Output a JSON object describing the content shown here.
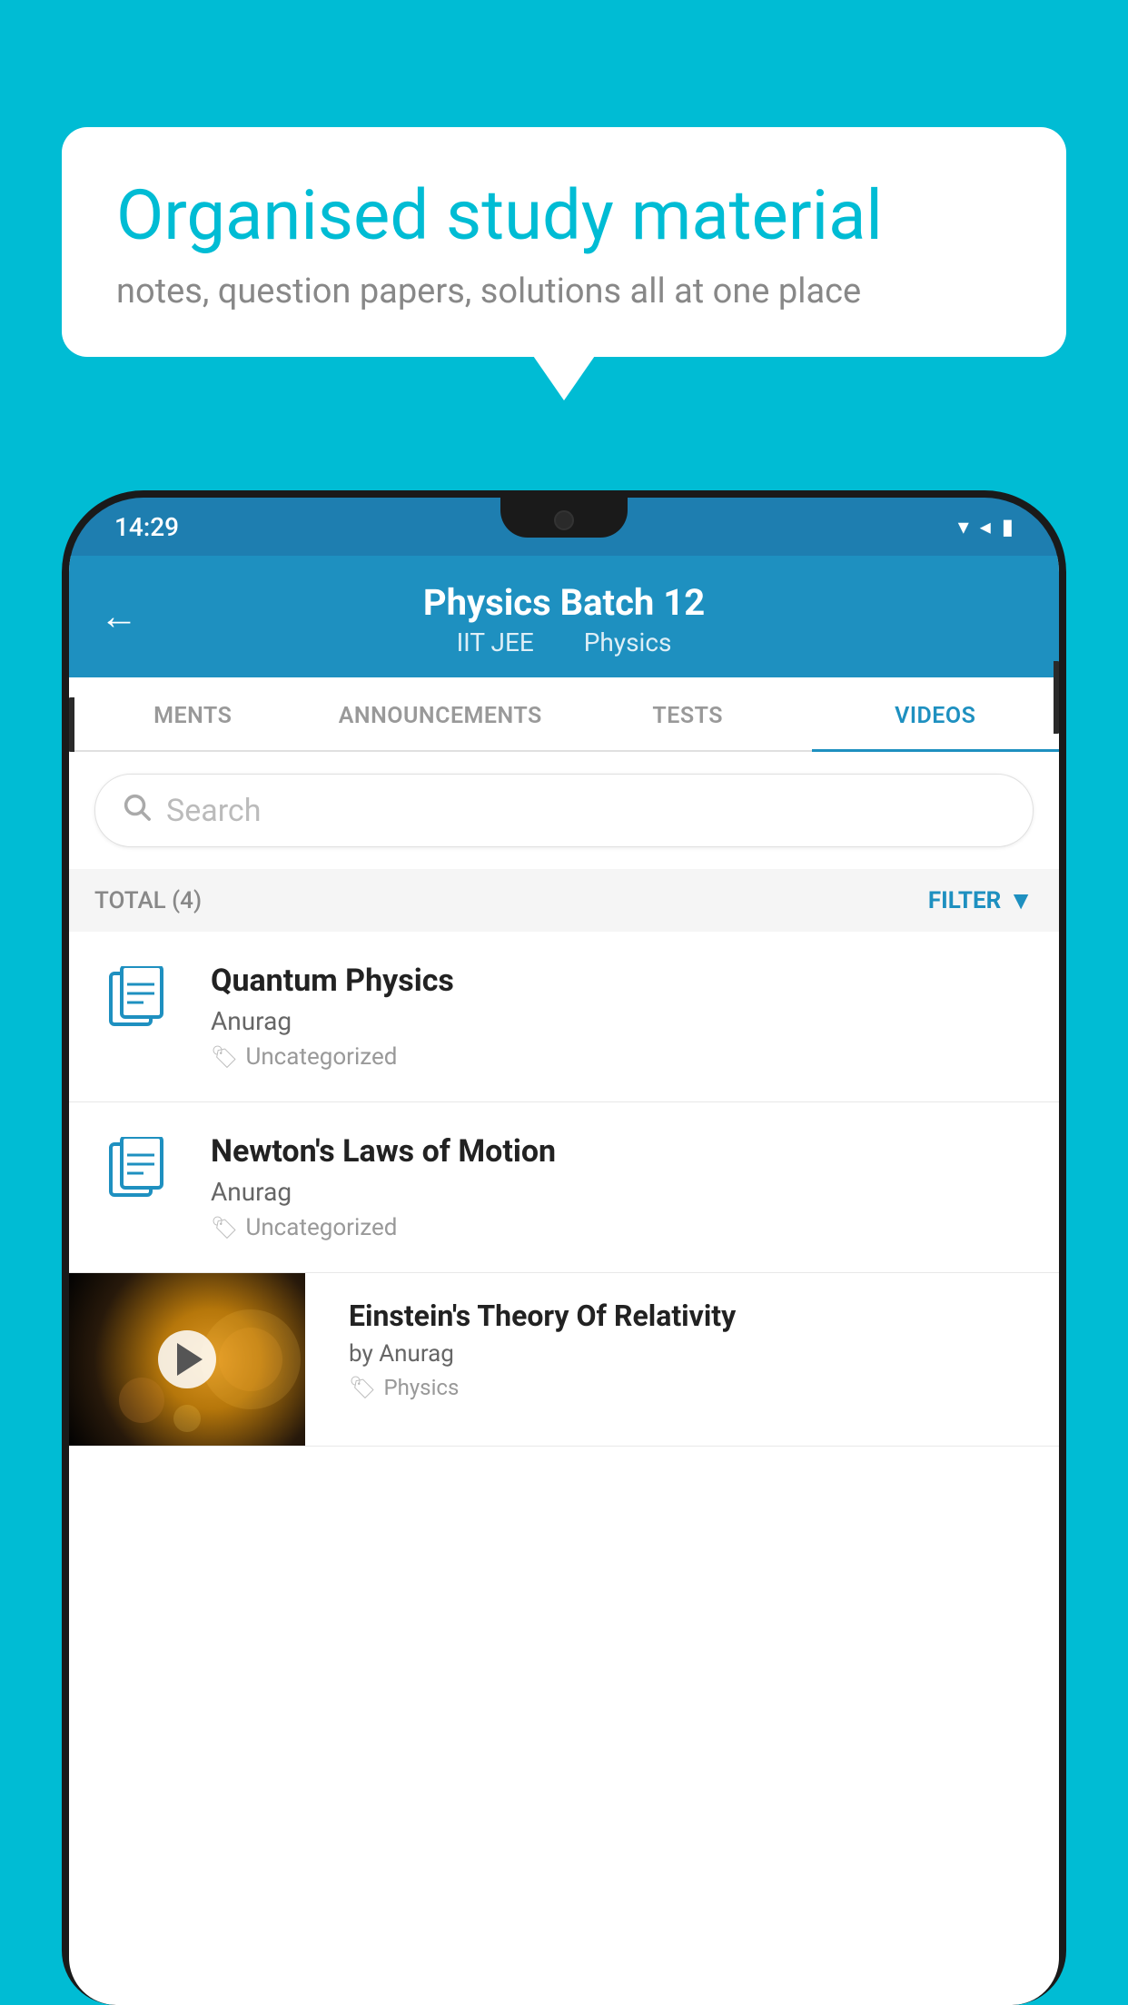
{
  "background_color": "#00bcd4",
  "bubble": {
    "title": "Organised study material",
    "subtitle": "notes, question papers, solutions all at one place"
  },
  "status_bar": {
    "time": "14:29",
    "wifi": "▼",
    "signal": "◀",
    "battery": "▌"
  },
  "header": {
    "back_label": "←",
    "title": "Physics Batch 12",
    "subtitle_part1": "IIT JEE",
    "subtitle_part2": "Physics"
  },
  "tabs": [
    {
      "label": "MENTS",
      "active": false
    },
    {
      "label": "ANNOUNCEMENTS",
      "active": false
    },
    {
      "label": "TESTS",
      "active": false
    },
    {
      "label": "VIDEOS",
      "active": true
    }
  ],
  "search": {
    "placeholder": "Search"
  },
  "filter_bar": {
    "total": "TOTAL (4)",
    "filter_label": "FILTER"
  },
  "videos": [
    {
      "title": "Quantum Physics",
      "author": "Anurag",
      "tag": "Uncategorized",
      "has_thumb": false
    },
    {
      "title": "Newton's Laws of Motion",
      "author": "Anurag",
      "tag": "Uncategorized",
      "has_thumb": false
    },
    {
      "title": "Einstein's Theory Of Relativity",
      "author": "by Anurag",
      "tag": "Physics",
      "has_thumb": true
    }
  ]
}
